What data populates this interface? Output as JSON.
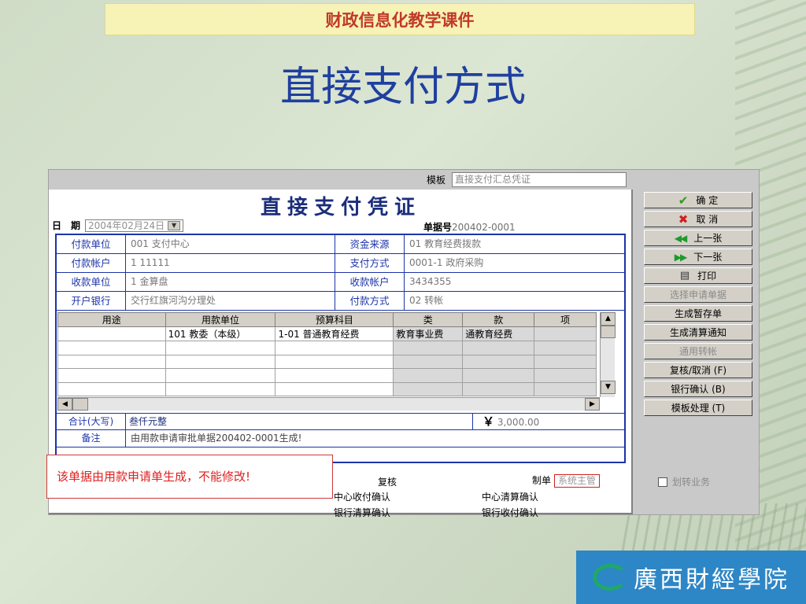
{
  "banner": "财政信息化教学课件",
  "slide_title": "直接支付方式",
  "window": {
    "template_label": "模板",
    "template_value": "直接支付汇总凭证",
    "voucher_title": "直接支付凭证",
    "date_label": "日　期",
    "date_value": "2004年02月24日",
    "docno_label": "单据号",
    "docno_value": "200402-0001",
    "fields": [
      {
        "l1": "付款单位",
        "v1": "001 支付中心",
        "l2": "资金来源",
        "v2": "01 教育经费拨款"
      },
      {
        "l1": "付款帐户",
        "v1": "1 11111",
        "l2": "支付方式",
        "v2": "0001-1 政府采购"
      },
      {
        "l1": "收款单位",
        "v1": "1 金算盘",
        "l2": "收款帐户",
        "v2": "3434355"
      },
      {
        "l1": "开户银行",
        "v1": "交行红旗河沟分理处",
        "l2": "付款方式",
        "v2": "02 转帐"
      }
    ],
    "table": {
      "headers": [
        "用途",
        "用款单位",
        "预算科目",
        "类",
        "款",
        "项"
      ],
      "rows": [
        [
          "",
          "101 教委（本级）",
          "1-01 普通教育经费",
          "教育事业费",
          "通教育经费",
          ""
        ]
      ]
    },
    "sum_label": "合计(大写)",
    "sum_text": "叁仟元整",
    "sum_currency": "￥",
    "sum_amount": "3,000.00",
    "note_label": "备注",
    "note_text": "由用款申请审批单据200402-0001生成!",
    "sign": {
      "review": "复核",
      "maker": "制单",
      "maker_value": "系统主管",
      "center_pay": "中心收付确认",
      "center_clear": "中心清算确认",
      "bank_clear": "银行清算确认",
      "bank_pay": "银行收付确认"
    },
    "buttons": [
      {
        "label": "确 定",
        "icon": "check-icon",
        "enabled": true
      },
      {
        "label": "取 消",
        "icon": "cross-icon",
        "enabled": true
      },
      {
        "label": "上一张",
        "icon": "prev-arrows-icon",
        "enabled": true
      },
      {
        "label": "下一张",
        "icon": "next-arrows-icon",
        "enabled": true
      },
      {
        "label": "打印",
        "icon": "printer-icon",
        "enabled": true
      },
      {
        "label": "选择申请单据",
        "icon": "",
        "enabled": false
      },
      {
        "label": "生成暂存单",
        "icon": "",
        "enabled": true
      },
      {
        "label": "生成清算通知",
        "icon": "",
        "enabled": true
      },
      {
        "label": "通用转帐",
        "icon": "",
        "enabled": false
      },
      {
        "label": "复核/取消 (F)",
        "icon": "",
        "enabled": true
      },
      {
        "label": "银行确认 (B)",
        "icon": "",
        "enabled": true
      },
      {
        "label": "模板处理 (T)",
        "icon": "",
        "enabled": true
      }
    ],
    "checkbox_label": "划转业务"
  },
  "warning": "该单据由用款申请单生成，不能修改!",
  "logo_text": "廣西財經學院"
}
